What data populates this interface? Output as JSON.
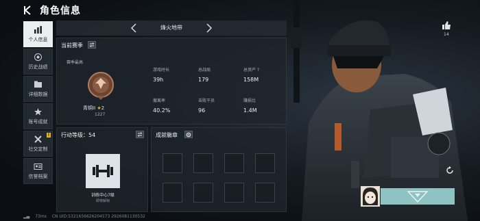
{
  "header": {
    "title": "角色信息"
  },
  "sidebar": {
    "items": [
      {
        "label": "个人信息",
        "icon": "bar-chart-icon",
        "active": true
      },
      {
        "label": "历史战绩",
        "icon": "target-icon"
      },
      {
        "label": "详细数据",
        "icon": "folder-icon"
      },
      {
        "label": "账号成就",
        "icon": "medal-icon"
      },
      {
        "label": "社交定制",
        "icon": "tools-icon",
        "badge": "!"
      },
      {
        "label": "信誉档案",
        "icon": "id-card-icon"
      }
    ]
  },
  "season_selector": {
    "name": "烽火地带"
  },
  "current_season": {
    "title": "当前赛季",
    "peak_label": "赛季最高",
    "rank_name": "青铜II",
    "rank_stars": "2",
    "rank_score": "1227",
    "stats": [
      {
        "label": "游戏时长",
        "value": "39h"
      },
      {
        "label": "总战局",
        "value": "179"
      },
      {
        "label": "总资产",
        "value": "158M",
        "help": "?"
      },
      {
        "label": "撤离率",
        "value": "40.2%"
      },
      {
        "label": "击败干员",
        "value": "96"
      },
      {
        "label": "赚损比",
        "value": "1.4M"
      }
    ]
  },
  "action_level": {
    "title": "行动等级：",
    "level": "54",
    "center": "训练中心7级",
    "unlock_hint": "即将解锁"
  },
  "achievements": {
    "title": "成就徽章"
  },
  "social": {
    "like_count": "14"
  },
  "footer": {
    "latency": "73ms",
    "uid": "CN UID:5321656626204573 2926081130532"
  },
  "colors": {
    "panel_bg": "#1e252c",
    "accent_active": "#e9eef1",
    "badge": "#e8b425",
    "namecard": "#8fc2c2"
  }
}
